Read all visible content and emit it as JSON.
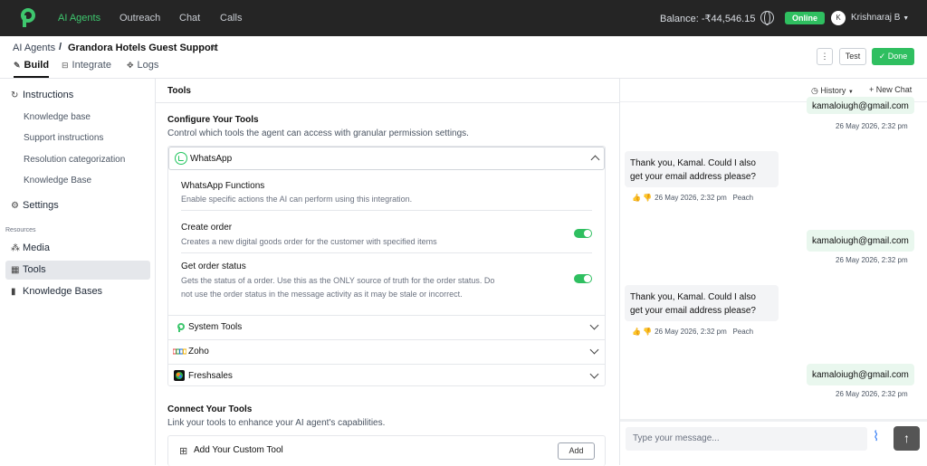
{
  "colors": {
    "topbar": "#252525",
    "accent": "#2fbf60",
    "active_nav": "#3ec76e"
  },
  "topbar": {
    "nav": [
      "AI Agents",
      "Outreach",
      "Chat",
      "Calls"
    ],
    "balance": "Balance: -₹44,546.15",
    "status": "Online",
    "avatar_initial": "K",
    "user": "Krishnaraj B"
  },
  "header": {
    "breadcrumb_root": "AI Agents",
    "breadcrumb_sep": "/",
    "breadcrumb_current": "Grandora Hotels Guest Support",
    "tabs": [
      "Build",
      "Integrate",
      "Logs"
    ],
    "kebab": "⋮",
    "test": "Test",
    "done": "Done"
  },
  "sidebar": {
    "instructions": "Instructions",
    "instr_items": [
      "Knowledge base",
      "Support instructions",
      "Resolution categorization",
      "Knowledge Base"
    ],
    "settings": "Settings",
    "resources_label": "Resources",
    "resources": [
      "Media",
      "Tools",
      "Knowledge Bases"
    ]
  },
  "main": {
    "title": "Tools",
    "configure_title": "Configure Your Tools",
    "configure_desc": "Control which tools the agent can access with granular permission settings.",
    "whatsapp": {
      "name": "WhatsApp",
      "functions_title": "WhatsApp Functions",
      "functions_desc": "Enable specific actions the AI can perform using this integration.",
      "items": [
        {
          "title": "Create order",
          "desc": "Creates a new digital goods order for the customer with specified items",
          "enabled": true
        },
        {
          "title": "Get order status",
          "desc_line1": "Gets the status of a order. Use this as the ONLY source of truth for the order status. Do",
          "desc_line2": "not use the order status in the message activity as it may be stale or incorrect.",
          "enabled": true
        }
      ]
    },
    "tools": [
      "System Tools",
      "Zoho",
      "Freshsales"
    ],
    "connect_title": "Connect Your Tools",
    "connect_desc": "Link your tools to enhance your AI agent's capabilities.",
    "custom_tool": "Add Your Custom Tool",
    "add": "Add"
  },
  "chat": {
    "history": "History",
    "new_chat": "+ New Chat",
    "messages": [
      {
        "type": "out",
        "text": "kamaloiugh@gmail.com",
        "time": "26 May 2026, 2:32 pm"
      },
      {
        "type": "in",
        "line1": "Thank you, Kamal. Could I also",
        "line2": "get your email address please?",
        "time": "26 May 2026, 2:32 pm",
        "agent": "Peach"
      },
      {
        "type": "out",
        "text": "kamaloiugh@gmail.com",
        "time": "26 May 2026, 2:32 pm"
      },
      {
        "type": "in",
        "line1": "Thank you, Kamal. Could I also",
        "line2": "get your email address please?",
        "time": "26 May 2026, 2:32 pm",
        "agent": "Peach"
      },
      {
        "type": "out",
        "text": "kamaloiugh@gmail.com",
        "time": "26 May 2026, 2:32 pm"
      }
    ],
    "placeholder": "Type your message..."
  }
}
